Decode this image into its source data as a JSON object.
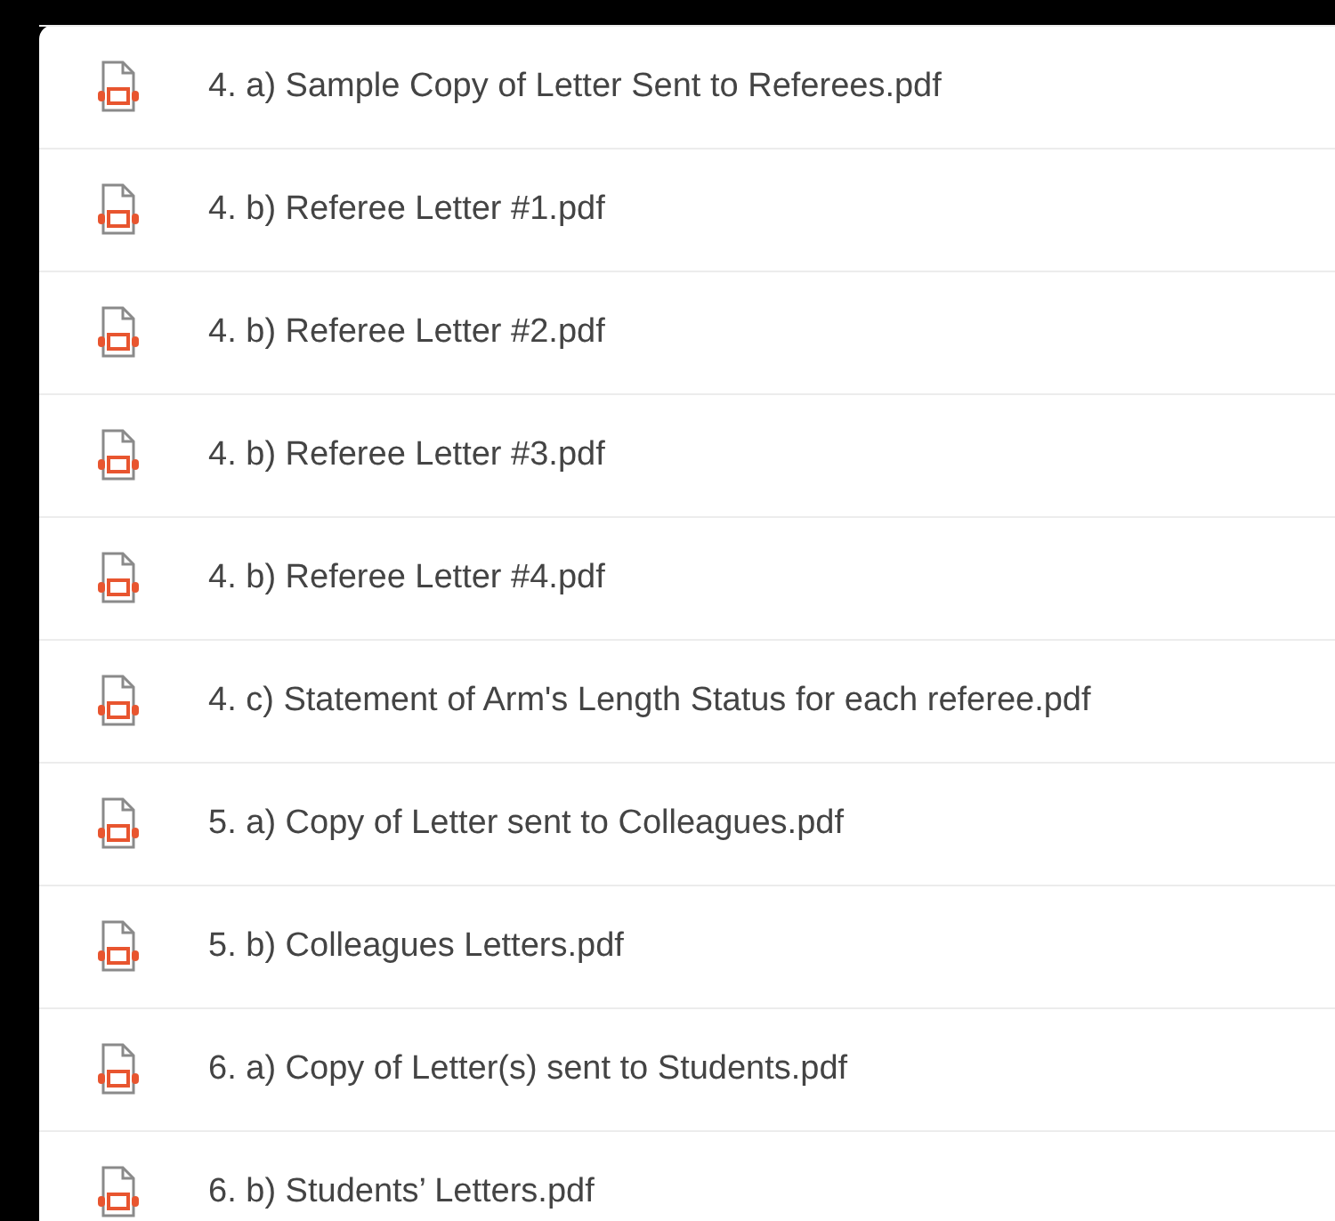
{
  "files": [
    {
      "name": "4. a) Sample Copy of Letter Sent to Referees.pdf"
    },
    {
      "name": "4. b) Referee Letter #1.pdf"
    },
    {
      "name": "4. b) Referee Letter #2.pdf"
    },
    {
      "name": "4. b) Referee Letter #3.pdf"
    },
    {
      "name": "4. b) Referee Letter #4.pdf"
    },
    {
      "name": "4. c) Statement of Arm's Length Status for each referee.pdf"
    },
    {
      "name": "5. a) Copy of Letter sent to Colleagues.pdf"
    },
    {
      "name": "5. b) Colleagues Letters.pdf"
    },
    {
      "name": "6. a) Copy of Letter(s) sent to Students.pdf"
    },
    {
      "name": "6. b) Students’ Letters.pdf"
    }
  ]
}
